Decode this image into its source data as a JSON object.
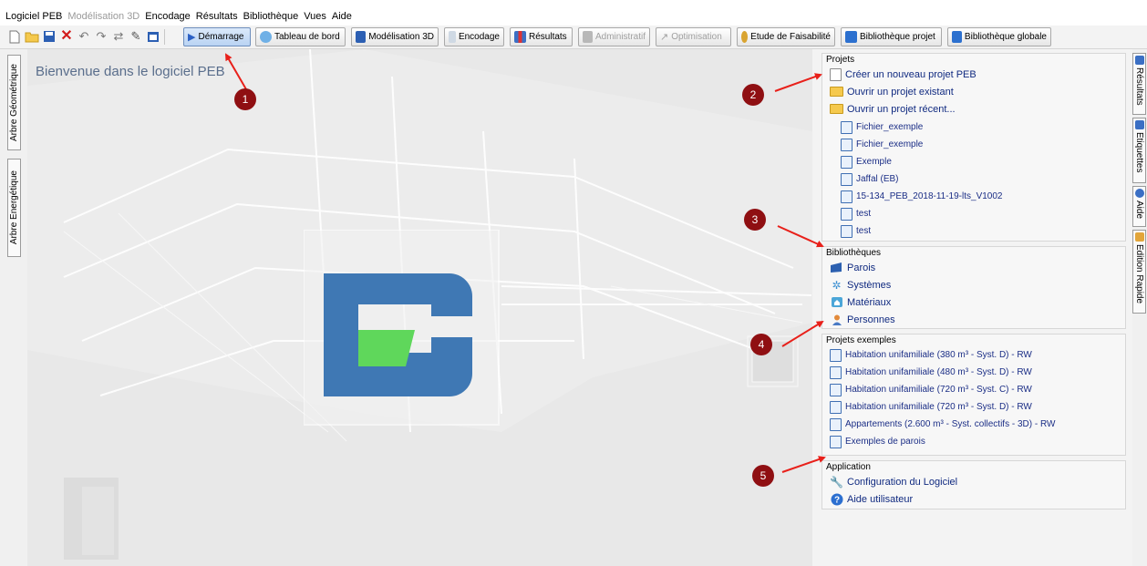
{
  "menubar": {
    "items": [
      "Logiciel PEB",
      "Modélisation 3D",
      "Encodage",
      "Résultats",
      "Bibliothèque",
      "Vues",
      "Aide"
    ],
    "disabled": [
      "Modélisation 3D"
    ]
  },
  "toolbar": {
    "buttons": {
      "demarrage": "Démarrage",
      "tableau": "Tableau de bord",
      "modelisation": "Modélisation 3D",
      "encodage": "Encodage",
      "resultats": "Résultats",
      "administratif": "Administratif",
      "optimisation": "Optimisation",
      "faisabilite": "Etude de Faisabilité",
      "bib_projet": "Bibliothèque projet",
      "bib_globale": "Bibliothèque globale"
    }
  },
  "left_tabs": [
    "Arbre Géométrique",
    "Arbre Energétique"
  ],
  "welcome": "Bienvenue dans le logiciel PEB",
  "panel": {
    "projets": {
      "title": "Projets",
      "new": "Créer un nouveau projet PEB",
      "open": "Ouvrir un projet existant",
      "recent": "Ouvrir un projet récent...",
      "recent_files": [
        "Fichier_exemple",
        "Fichier_exemple",
        "Exemple",
        "Jaffal (EB)",
        "15-134_PEB_2018-11-19-lts_V1002",
        "test",
        "test"
      ]
    },
    "bibliotheques": {
      "title": "Bibliothèques",
      "items": [
        "Parois",
        "Systèmes",
        "Matériaux",
        "Personnes"
      ]
    },
    "exemples": {
      "title": "Projets exemples",
      "items": [
        "Habitation unifamiliale (380 m³ - Syst. D) - RW",
        "Habitation unifamiliale (480 m³ - Syst. D) - RW",
        "Habitation unifamiliale (720 m³ - Syst. C) - RW",
        "Habitation unifamiliale (720 m³ - Syst. D) - RW",
        "Appartements (2.600 m³ - Syst. collectifs - 3D) - RW",
        "Exemples de parois"
      ]
    },
    "application": {
      "title": "Application",
      "config": "Configuration du Logiciel",
      "aide": "Aide utilisateur"
    }
  },
  "right_tabs": [
    "Résultats",
    "Etiquettes",
    "Aide",
    "Edition Rapide"
  ],
  "markers": [
    "1",
    "2",
    "3",
    "4",
    "5"
  ],
  "colors": {
    "marker": "#8f0f12",
    "arrow": "#e8201a",
    "logo_blue": "#3f78b4",
    "logo_green": "#5fd75b",
    "link": "#102a80"
  }
}
